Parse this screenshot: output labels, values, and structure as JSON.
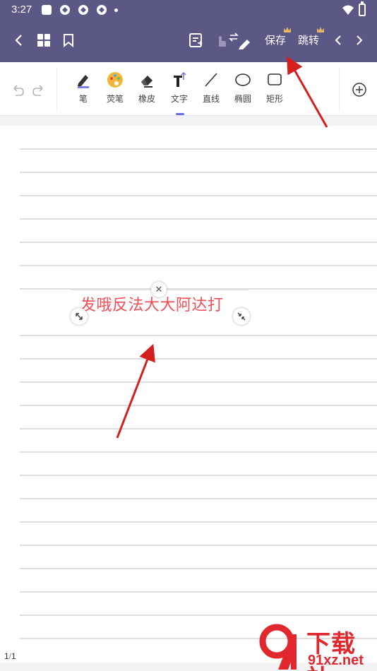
{
  "status_bar": {
    "time": "3:27"
  },
  "top_bar": {
    "save_label": "保存",
    "jump_label": "跳转",
    "bg_color": "#5b5886"
  },
  "toolbar": {
    "tools": [
      {
        "label": "笔",
        "icon": "pen-icon"
      },
      {
        "label": "荧笔",
        "icon": "palette-icon"
      },
      {
        "label": "橡皮",
        "icon": "eraser-icon"
      },
      {
        "label": "文字",
        "icon": "text-icon"
      },
      {
        "label": "直线",
        "icon": "line-icon"
      },
      {
        "label": "椭圆",
        "icon": "ellipse-icon"
      },
      {
        "label": "矩形",
        "icon": "rectangle-icon"
      }
    ],
    "active_tool": "文字",
    "accent_color": "#6c6ee8"
  },
  "canvas": {
    "text_box_content": "发哦反法大大阿达打",
    "text_color": "#f04f57"
  },
  "page_indicator": {
    "current": "1",
    "total": "1"
  },
  "watermark": {
    "line1": "下载站",
    "line2": "91xz.net",
    "color": "#e0282e"
  }
}
